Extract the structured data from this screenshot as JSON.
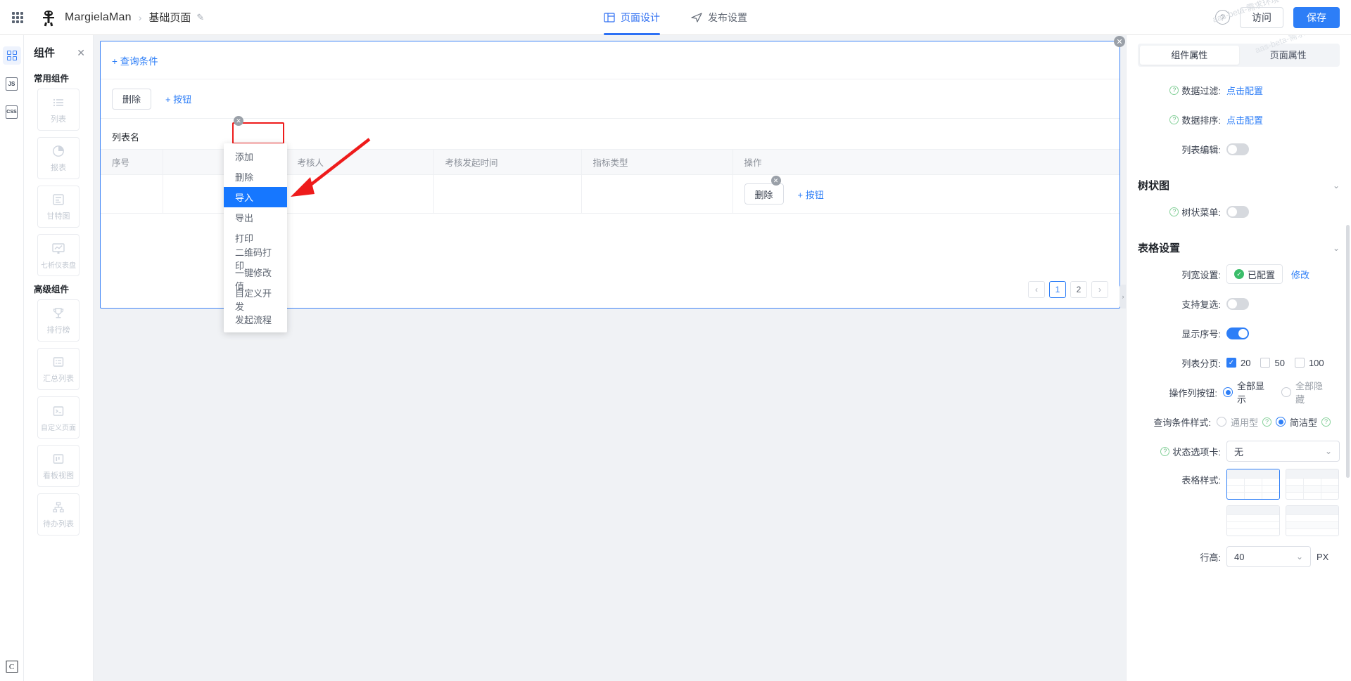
{
  "topbar": {
    "brand": "MargielaMan",
    "breadcrumb_sep": "›",
    "page_name": "基础页面",
    "pencil": "✎",
    "tabs": [
      {
        "label": "页面设计",
        "icon": "layout-icon",
        "active": true
      },
      {
        "label": "发布设置",
        "icon": "send-icon",
        "active": false
      }
    ],
    "help": "?",
    "visit_label": "访问",
    "save_label": "保存",
    "watermark": "aas-beta-需求环境",
    "accent": "#2d7ef7"
  },
  "rail": {
    "items": [
      {
        "name": "components",
        "glyph": "grid",
        "active": true
      },
      {
        "name": "js",
        "glyph": "JS",
        "active": false
      },
      {
        "name": "css",
        "glyph": "CSS",
        "active": false
      }
    ],
    "bottom_badge": "C"
  },
  "components_panel": {
    "title": "组件",
    "close": "✕",
    "groups": [
      {
        "title": "常用组件",
        "items": [
          {
            "label": "列表",
            "icon": "list-icon"
          },
          {
            "label": "报表",
            "icon": "pie-chart-icon"
          },
          {
            "label": "甘特图",
            "icon": "gantt-icon"
          },
          {
            "label": "七析仪表盘",
            "icon": "dashboard-icon"
          }
        ]
      },
      {
        "title": "高级组件",
        "items": [
          {
            "label": "排行榜",
            "icon": "trophy-icon"
          },
          {
            "label": "汇总列表",
            "icon": "summary-list-icon"
          },
          {
            "label": "自定义页面",
            "icon": "terminal-icon"
          },
          {
            "label": "看板视图",
            "icon": "kanban-icon"
          },
          {
            "label": "待办列表",
            "icon": "org-tree-icon"
          }
        ]
      }
    ]
  },
  "canvas": {
    "close_badge": "✕",
    "query_condition": "+ 查询条件",
    "toolbar": {
      "delete_label": "删除",
      "add_button_label": "+ 按钮",
      "badge": "✕"
    },
    "dropdown": {
      "items": [
        {
          "label": "添加",
          "selected": false
        },
        {
          "label": "删除",
          "selected": false
        },
        {
          "label": "导入",
          "selected": true
        },
        {
          "label": "导出",
          "selected": false
        },
        {
          "label": "打印",
          "selected": false
        },
        {
          "label": "二维码打印",
          "selected": false
        },
        {
          "label": "一键修改值",
          "selected": false
        },
        {
          "label": "自定义开发",
          "selected": false
        },
        {
          "label": "发起流程",
          "selected": false
        }
      ]
    },
    "list_label": "列表名",
    "table": {
      "columns": [
        "序号",
        "",
        "考核人",
        "考核发起时间",
        "指标类型",
        "操作"
      ],
      "rows": [
        {
          "cells": [
            "",
            "",
            "",
            "",
            ""
          ],
          "action_delete": "删除",
          "action_add": "+ 按钮",
          "action_badge": "✕"
        }
      ]
    },
    "pagination": {
      "prev": "‹",
      "pages": [
        "1",
        "2"
      ],
      "current": "1",
      "next": "›"
    },
    "collapse_handle": "›"
  },
  "right_panel": {
    "tabs": [
      {
        "label": "组件属性",
        "active": true
      },
      {
        "label": "页面属性",
        "active": false
      }
    ],
    "fields": [
      {
        "label": "数据过滤:",
        "help": true,
        "type": "link",
        "value": "点击配置"
      },
      {
        "label": "数据排序:",
        "help": true,
        "type": "link",
        "value": "点击配置"
      },
      {
        "label": "列表编辑:",
        "help": false,
        "type": "switch",
        "on": false
      }
    ],
    "tree_section": {
      "title": "树状图",
      "chevron": "⌄",
      "fields": [
        {
          "label": "树状菜单:",
          "help": true,
          "type": "switch",
          "on": false
        }
      ]
    },
    "table_section": {
      "title": "表格设置",
      "chevron": "⌄",
      "column_width": {
        "label": "列宽设置:",
        "status": "已配置",
        "status_icon": "✓",
        "modify": "修改"
      },
      "multi_select": {
        "label": "支持复选:",
        "on": false
      },
      "show_index": {
        "label": "显示序号:",
        "on": true
      },
      "pagination": {
        "label": "列表分页:",
        "options": [
          {
            "value": "20",
            "checked": true
          },
          {
            "value": "50",
            "checked": false
          },
          {
            "value": "100",
            "checked": false
          }
        ]
      },
      "action_buttons": {
        "label": "操作列按钮:",
        "options": [
          {
            "value": "全部显示",
            "checked": true
          },
          {
            "value": "全部隐藏",
            "checked": false
          }
        ]
      },
      "query_style": {
        "label": "查询条件样式:",
        "options": [
          {
            "value": "通用型",
            "checked": false,
            "help": true
          },
          {
            "value": "简洁型",
            "checked": true,
            "help": true
          }
        ]
      },
      "status_tab": {
        "label": "状态选项卡:",
        "help": true,
        "value": "无",
        "chevron": "⌄"
      },
      "table_style": {
        "label": "表格样式:",
        "options": [
          {
            "id": "style-1",
            "selected": true
          },
          {
            "id": "style-2",
            "selected": false
          },
          {
            "id": "style-3",
            "selected": false
          },
          {
            "id": "style-4",
            "selected": false
          }
        ]
      },
      "row_height": {
        "label": "行高:",
        "value": "40",
        "unit": "PX",
        "chevron": "⌄"
      }
    }
  }
}
